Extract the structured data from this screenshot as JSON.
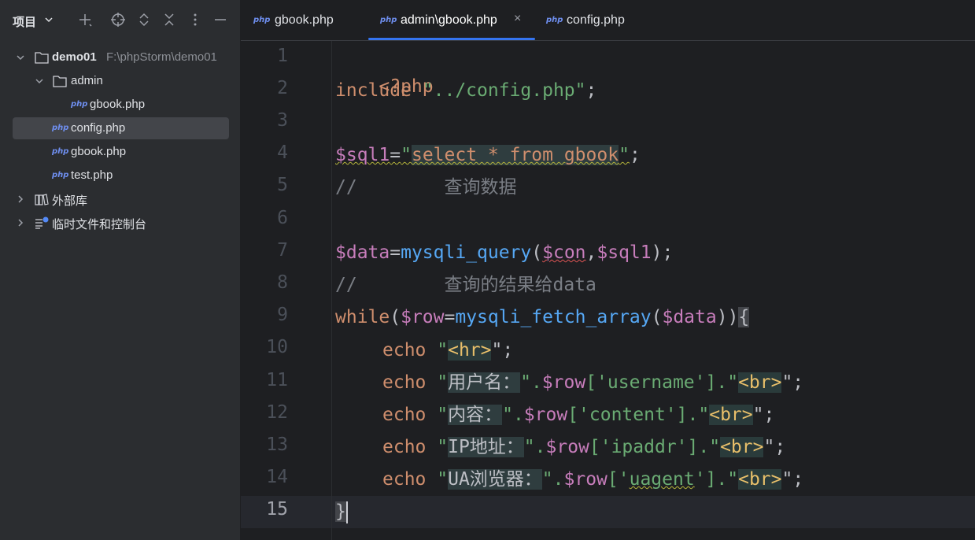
{
  "sidebar": {
    "title": "项目",
    "tree": [
      {
        "label": "demo01",
        "path": "F:\\phpStorm\\demo01"
      },
      {
        "label": "admin"
      },
      {
        "label": "gbook.php",
        "badge": "php"
      },
      {
        "label": "config.php",
        "badge": "php"
      },
      {
        "label": "gbook.php",
        "badge": "php"
      },
      {
        "label": "test.php",
        "badge": "php"
      },
      {
        "label": "外部库"
      },
      {
        "label": "临时文件和控制台"
      }
    ]
  },
  "tabs": [
    {
      "badge": "php",
      "label": "gbook.php"
    },
    {
      "badge": "php",
      "label": "admin\\gbook.php",
      "close": "×"
    },
    {
      "badge": "php",
      "label": "config.php"
    }
  ],
  "gutter": [
    "1",
    "2",
    "3",
    "4",
    "5",
    "6",
    "7",
    "8",
    "9",
    "10",
    "11",
    "12",
    "13",
    "14",
    "15"
  ],
  "code": {
    "l1": "<?php",
    "l2_kw": "include",
    "l2_str": " \"../config.php\"",
    "l2_end": ";",
    "l4_var": "$sql1",
    "l4_eq": "=",
    "l4_q1": "\"",
    "l4_sql": "select * from gbook",
    "l4_q2": "\"",
    "l4_end": ";",
    "l5": "//        查询数据",
    "l7_var": "$data",
    "l7_eq": "=",
    "l7_fn": "mysqli_query",
    "l7_p1": "(",
    "l7_a1": "$con",
    "l7_c": ",",
    "l7_a2": "$sql1",
    "l7_end": ");",
    "l8": "//        查询的结果给data",
    "l9_kw": "while",
    "l9_p": "(",
    "l9_var": "$row",
    "l9_eq": "=",
    "l9_fn": "mysqli_fetch_array",
    "l9_p2": "(",
    "l9_arg": "$data",
    "l9_p3": "))",
    "l9_br": "{",
    "l10_kw": "echo",
    "l10_q1": " \"",
    "l10_tag": "<hr>",
    "l10_end": "\";",
    "l11_kw": "echo",
    "l11_q1": " \"",
    "l11_txt": "用户名：",
    "l11_q2": "\".",
    "l11_var": "$row",
    "l11_key": "['username']",
    "l11_dot": ".\"",
    "l11_tag": "<br>",
    "l11_end": "\";",
    "l12_kw": "echo",
    "l12_q1": " \"",
    "l12_txt": "内容：",
    "l12_q2": "\".",
    "l12_var": "$row",
    "l12_key": "['content']",
    "l12_dot": ".\"",
    "l12_tag": "<br>",
    "l12_end": "\";",
    "l13_kw": "echo",
    "l13_q1": " \"",
    "l13_txt": "IP地址：",
    "l13_q2": "\".",
    "l13_var": "$row",
    "l13_key": "['ipaddr']",
    "l13_dot": ".\"",
    "l13_tag": "<br>",
    "l13_end": "\";",
    "l14_kw": "echo",
    "l14_q1": " \"",
    "l14_txt": "UA浏览器：",
    "l14_q2": "\".",
    "l14_var": "$row",
    "l14_key1": "['",
    "l14_keyw": "uagent",
    "l14_key2": "']",
    "l14_dot": ".\"",
    "l14_tag": "<br>",
    "l14_end": "\";",
    "l15": "}"
  },
  "colors": {
    "accent": "#3574f0",
    "keyword": "#cf8e6d",
    "string": "#6aab73",
    "variable": "#c77dbb",
    "function": "#56a8f5",
    "comment": "#7a7e85"
  }
}
